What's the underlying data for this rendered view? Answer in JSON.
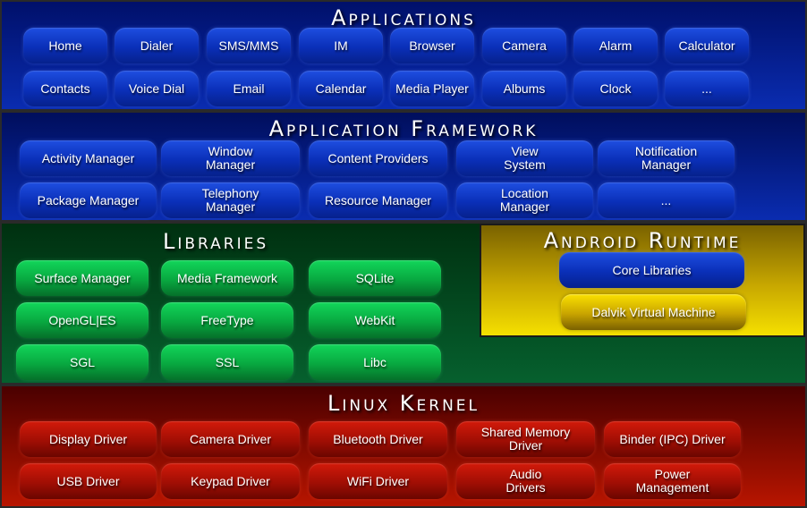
{
  "applications": {
    "title": "Applications",
    "row1": [
      "Home",
      "Dialer",
      "SMS/MMS",
      "IM",
      "Browser",
      "Camera",
      "Alarm",
      "Calculator"
    ],
    "row2": [
      "Contacts",
      "Voice Dial",
      "Email",
      "Calendar",
      "Media Player",
      "Albums",
      "Clock",
      "..."
    ]
  },
  "framework": {
    "title": "Application Framework",
    "row1": [
      "Activity Manager",
      "Window\nManager",
      "Content Providers",
      "View\nSystem",
      "Notification\nManager"
    ],
    "row2": [
      "Package Manager",
      "Telephony\nManager",
      "Resource Manager",
      "Location\nManager",
      "..."
    ]
  },
  "libraries": {
    "title": "Libraries",
    "row1": [
      "Surface Manager",
      "Media Framework",
      "SQLite"
    ],
    "row2": [
      "OpenGL|ES",
      "FreeType",
      "WebKit"
    ],
    "row3": [
      "SGL",
      "SSL",
      "Libc"
    ]
  },
  "runtime": {
    "title": "Android Runtime",
    "items": [
      "Core Libraries",
      "Dalvik Virtual Machine"
    ]
  },
  "kernel": {
    "title": "Linux Kernel",
    "row1": [
      "Display Driver",
      "Camera Driver",
      "Bluetooth Driver",
      "Shared Memory\nDriver",
      "Binder (IPC) Driver"
    ],
    "row2": [
      "USB Driver",
      "Keypad Driver",
      "WiFi Driver",
      "Audio\nDrivers",
      "Power\nManagement"
    ]
  },
  "colors": {
    "applications": "#0a2cb0",
    "framework": "#0a2cb0",
    "libraries": "#06602e",
    "runtime": "#f5e000",
    "kernel": "#b81500"
  }
}
